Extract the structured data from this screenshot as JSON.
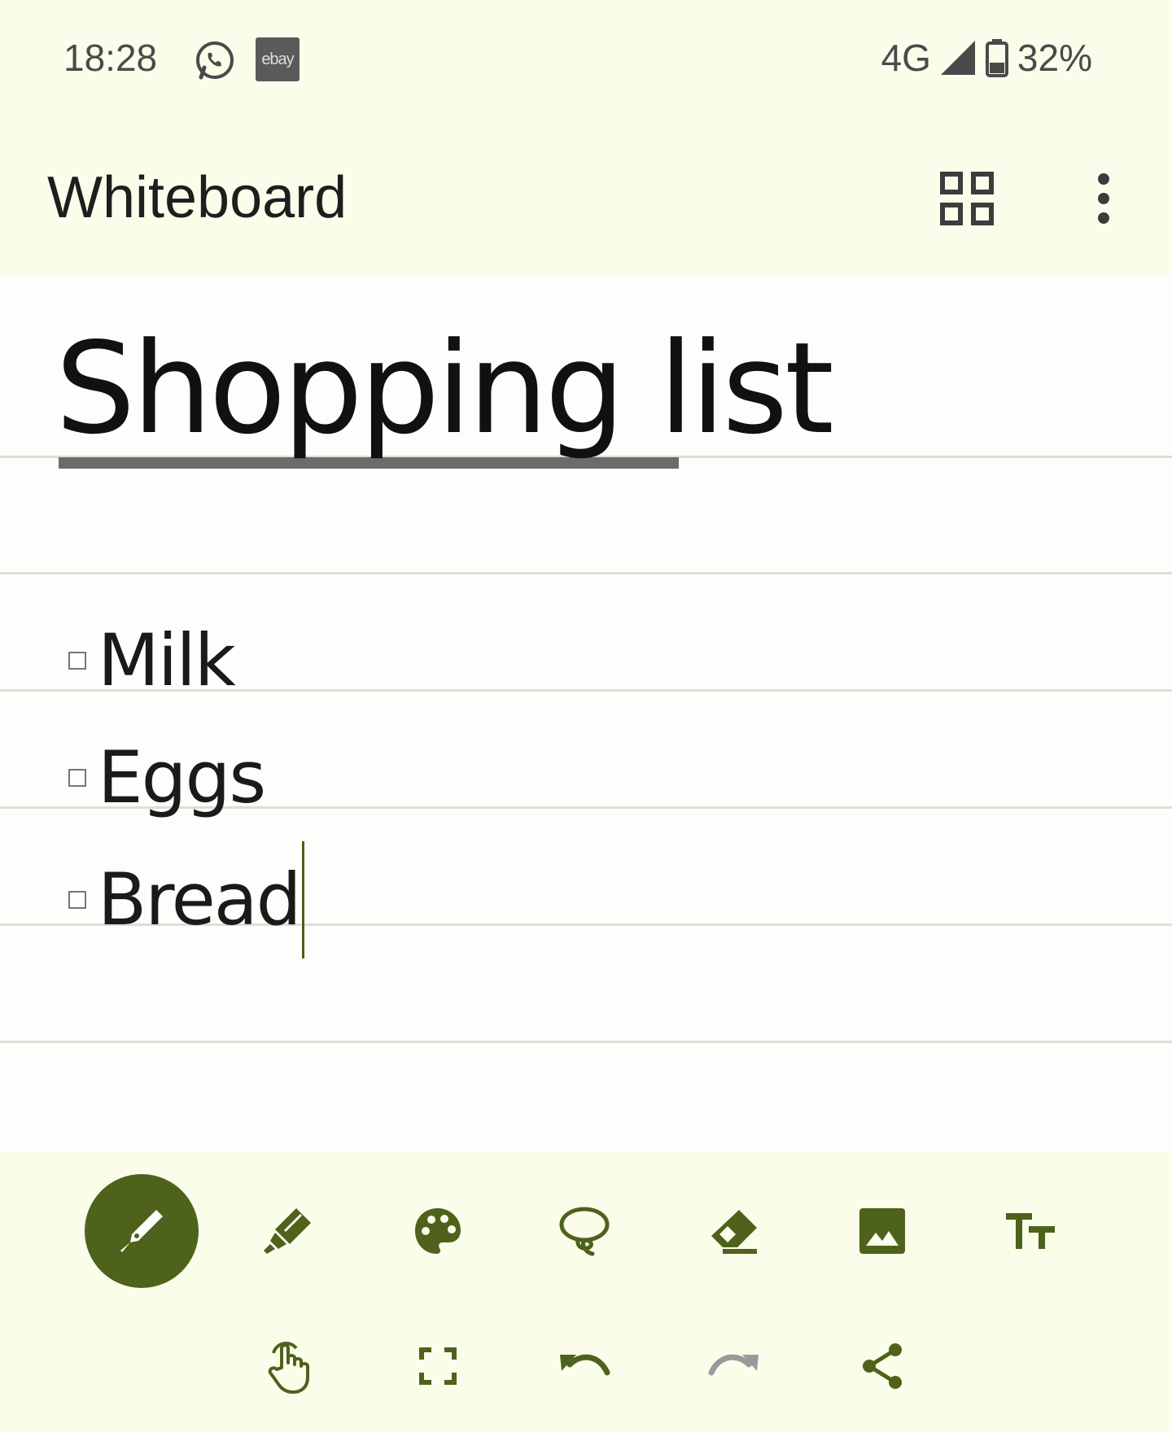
{
  "status_bar": {
    "time": "18:28",
    "ebay_label": "ebay",
    "network": "4G",
    "battery": "32%"
  },
  "app_bar": {
    "title": "Whiteboard"
  },
  "note": {
    "title": "Shopping list",
    "items": [
      "Milk",
      "Eggs",
      "Bread"
    ]
  },
  "toolbar": {
    "row1": [
      "pen-icon",
      "highlighter-icon",
      "palette-icon",
      "lasso-icon",
      "eraser-icon",
      "image-icon",
      "text-size-icon"
    ],
    "row2": [
      "touch-hand-icon",
      "fullscreen-icon",
      "undo-icon",
      "redo-icon",
      "share-icon"
    ]
  },
  "colors": {
    "accent": "#4e621c",
    "background": "#fafdea",
    "canvas": "#fdfdfb"
  }
}
